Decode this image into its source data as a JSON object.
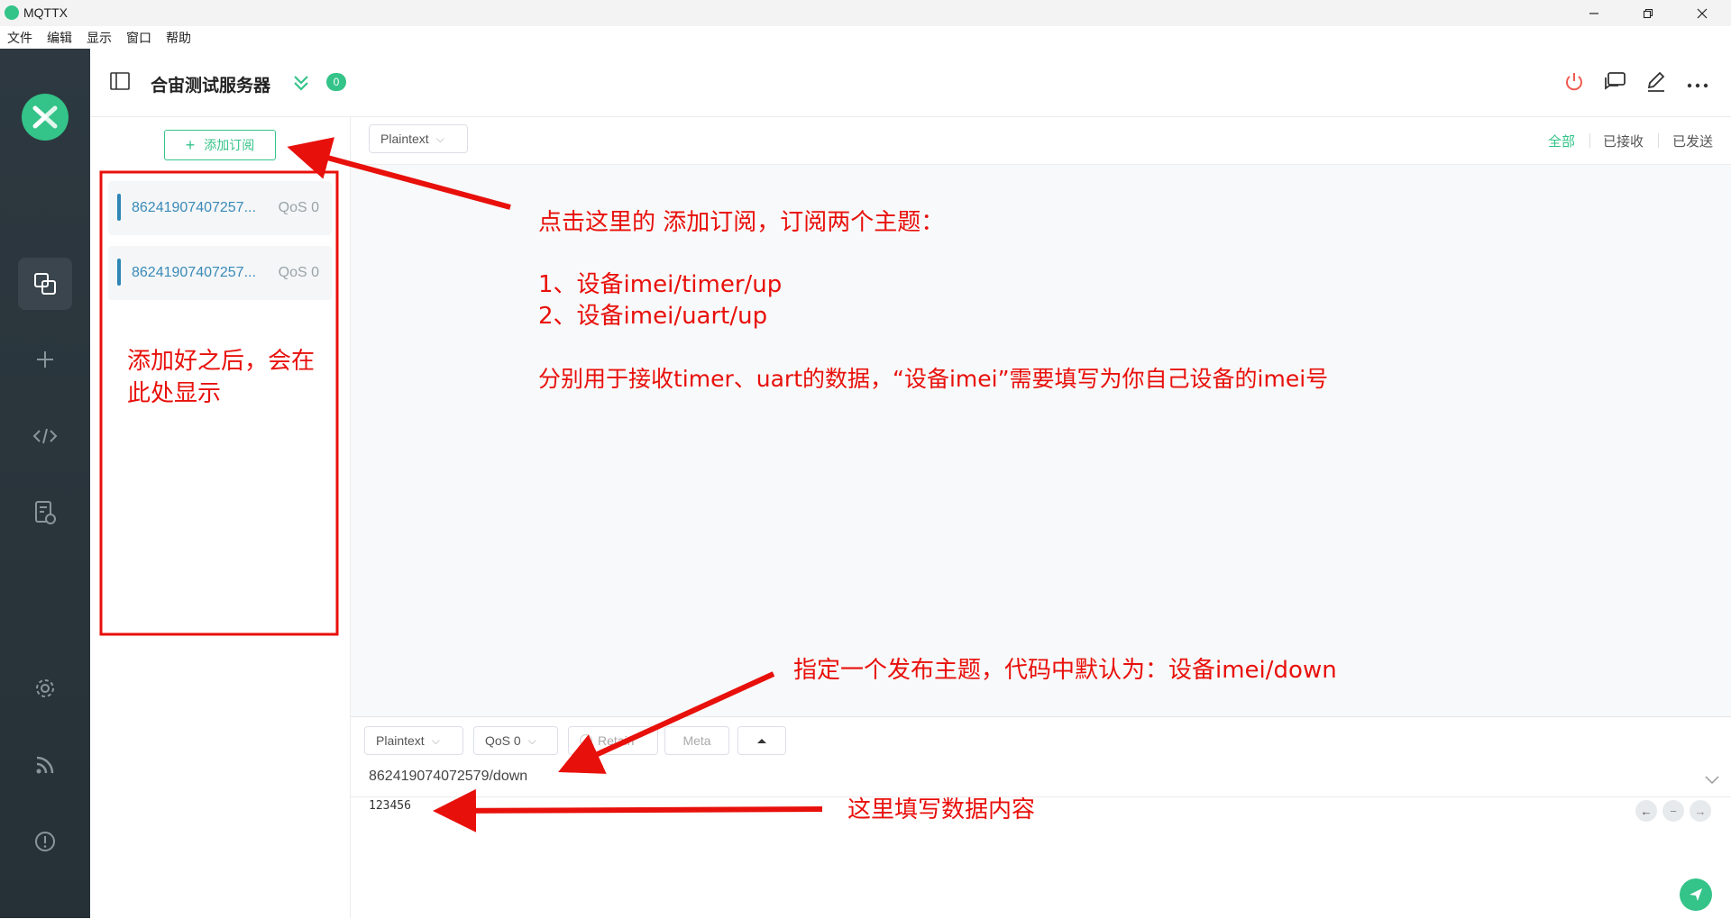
{
  "window": {
    "title": "MQTTX"
  },
  "menu": [
    "文件",
    "编辑",
    "显示",
    "窗口",
    "帮助"
  ],
  "header": {
    "connection_name": "合宙测试服务器",
    "message_count": "0"
  },
  "subscriptions": {
    "add_button": "添加订阅",
    "items": [
      {
        "topic": "86241907407257...",
        "qos": "QoS 0"
      },
      {
        "topic": "86241907407257...",
        "qos": "QoS 0"
      }
    ]
  },
  "messages": {
    "payload_format": "Plaintext",
    "filters": [
      "全部",
      "已接收",
      "已发送"
    ],
    "active_filter": "全部"
  },
  "publish": {
    "format": "Plaintext",
    "qos": "QoS 0",
    "retain_label": "Retain",
    "meta_label": "Meta",
    "topic": "862419074072579/down",
    "payload": "123456"
  },
  "annotations": {
    "subscribe_title": "点击这里的 添加订阅，订阅两个主题：",
    "subscribe_item1": "1、设备imei/timer/up",
    "subscribe_item2": "2、设备imei/uart/up",
    "subscribe_note": "分别用于接收timer、uart的数据，“设备imei”需要填写为你自己设备的imei号",
    "list_note_line1": "添加好之后，会在",
    "list_note_line2": "此处显示",
    "publish_topic_note": "指定一个发布主题，代码中默认为：设备imei/down",
    "payload_note": "这里填写数据内容"
  },
  "colors": {
    "accent": "#34c388",
    "sidebar": "#2b363d",
    "annotation": "#e8100b",
    "topic_blue": "#3a8ab8"
  },
  "icons": [
    "mqttx-logo",
    "connections-icon",
    "plus-icon",
    "code-icon",
    "log-icon",
    "gear-icon",
    "rss-icon",
    "info-icon",
    "sidebar-toggle-icon",
    "double-chevron-icon",
    "power-icon",
    "chat-icon",
    "edit-icon",
    "more-icon",
    "send-icon"
  ]
}
